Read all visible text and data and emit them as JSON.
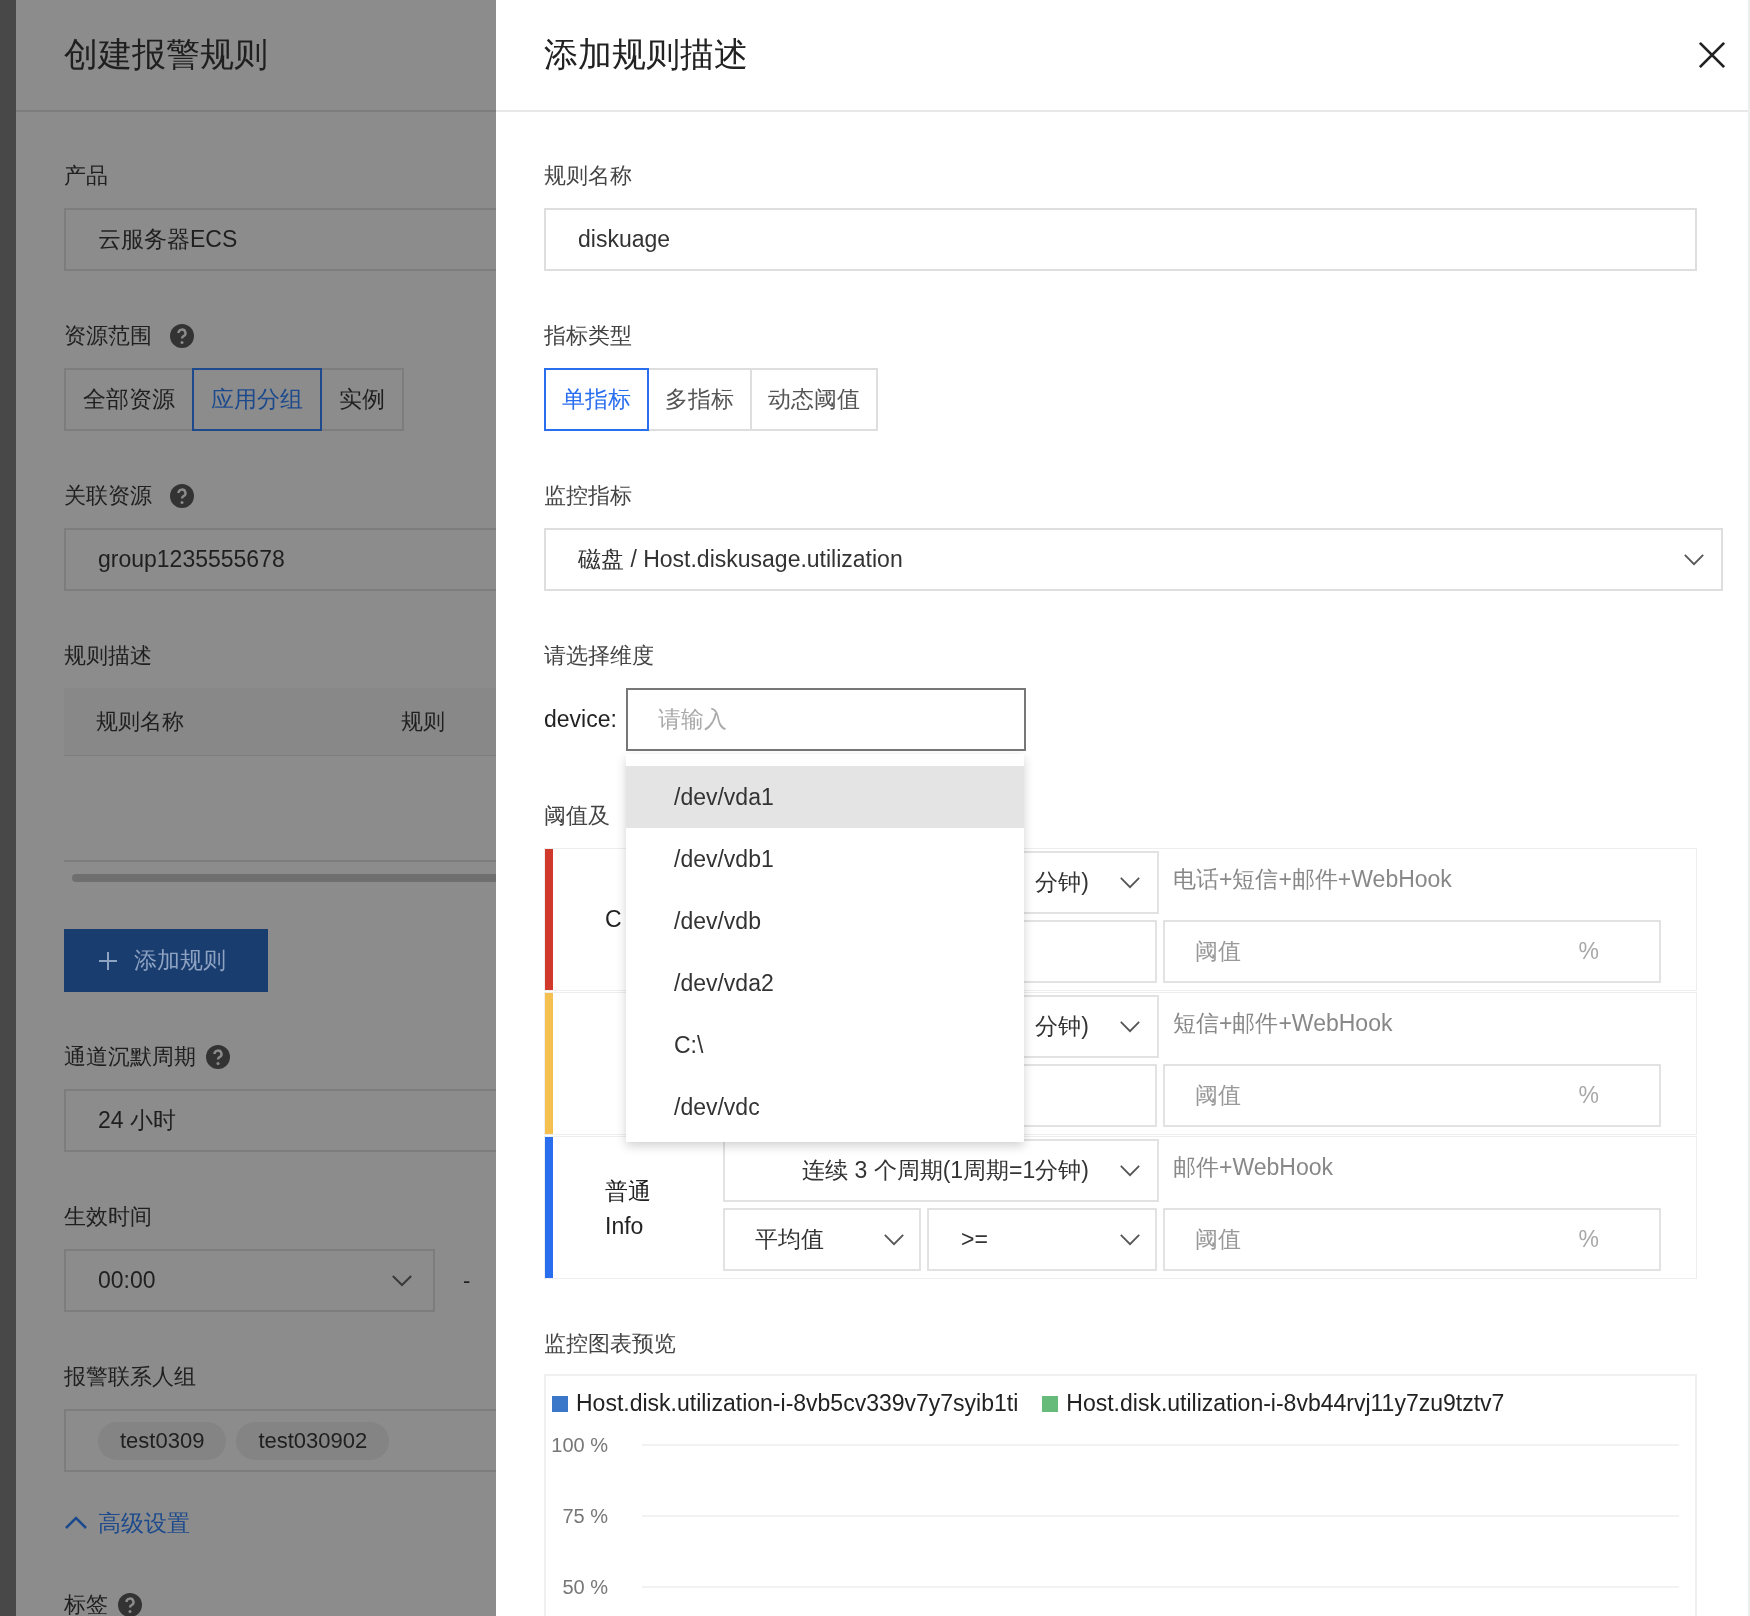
{
  "background_panel": {
    "title": "创建报警规则",
    "product": {
      "label": "产品",
      "value": "云服务器ECS"
    },
    "resource_scope": {
      "label": "资源范围",
      "options": [
        {
          "label": "全部资源",
          "selected": false
        },
        {
          "label": "应用分组",
          "selected": true
        },
        {
          "label": "实例",
          "selected": false
        }
      ]
    },
    "related_resource": {
      "label": "关联资源",
      "value": "group1235555678"
    },
    "rule_description": {
      "label": "规则描述",
      "columns": [
        "规则名称",
        "规则"
      ]
    },
    "add_rule_button": "添加规则",
    "silence_period": {
      "label": "通道沉默周期",
      "value": "24 小时"
    },
    "effective_time": {
      "label": "生效时间",
      "start": "00:00",
      "separator": "-"
    },
    "contact_groups": {
      "label": "报警联系人组",
      "tags": [
        "test0309",
        "test030902"
      ]
    },
    "advanced_settings": {
      "label": "高级设置",
      "expanded": true
    },
    "tags_label": "标签"
  },
  "drawer": {
    "title": "添加规则描述",
    "rule_name": {
      "label": "规则名称",
      "value": "diskuage"
    },
    "metric_type": {
      "label": "指标类型",
      "options": [
        {
          "label": "单指标",
          "selected": true
        },
        {
          "label": "多指标",
          "selected": false
        },
        {
          "label": "动态阈值",
          "selected": false
        }
      ]
    },
    "metric": {
      "label": "监控指标",
      "value": "磁盘 / Host.diskusage.utilization"
    },
    "dimension": {
      "label": "请选择维度",
      "key": "device:",
      "placeholder": "请输入",
      "options": [
        {
          "label": "/dev/vda1",
          "selected": true
        },
        {
          "label": "/dev/vdb1",
          "selected": false
        },
        {
          "label": "/dev/vdb",
          "selected": false
        },
        {
          "label": "/dev/vda2",
          "selected": false
        },
        {
          "label": "C:\\",
          "selected": false
        },
        {
          "label": "/dev/vdc",
          "selected": false
        }
      ]
    },
    "threshold": {
      "label": "阈值及",
      "levels": [
        {
          "color": "#d0392b",
          "level_lines": [
            "C"
          ],
          "period": "分钟)",
          "notify": "电话+短信+邮件+WebHook",
          "threshold_placeholder": "阈值",
          "unit": "%"
        },
        {
          "color": "#f5c04f",
          "period": "分钟)",
          "notify": "短信+邮件+WebHook",
          "threshold_placeholder": "阈值",
          "unit": "%"
        },
        {
          "color": "#2a6ef0",
          "level_lines": [
            "普通",
            "Info"
          ],
          "period": "连续 3 个周期(1周期=1分钟)",
          "notify": "邮件+WebHook",
          "statistic": "平均值",
          "operator": ">=",
          "threshold_placeholder": "阈值",
          "unit": "%"
        }
      ]
    },
    "preview": {
      "label": "监控图表预览",
      "chart_data": {
        "type": "line",
        "series": [
          {
            "name": "Host.disk.utilization-i-8vb5cv339v7y7syib1ti",
            "color": "#3b78c9"
          },
          {
            "name": "Host.disk.utilization-i-8vb44rvj11y7zu9tztv7",
            "color": "#66bb7a"
          }
        ],
        "ylim": [
          50,
          100
        ],
        "yticks": [
          {
            "value": 100,
            "label": "100 %"
          },
          {
            "value": 75,
            "label": "75 %"
          },
          {
            "value": 50,
            "label": "50 %"
          }
        ]
      }
    }
  }
}
